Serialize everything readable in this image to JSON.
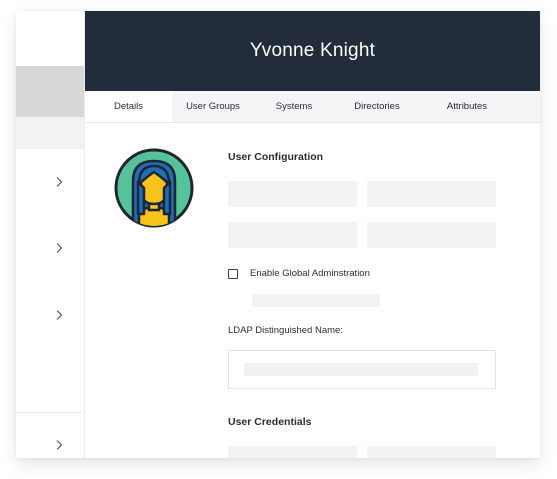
{
  "user": {
    "name": "Yvonne Knight"
  },
  "tabs": [
    {
      "label": "Details",
      "active": true
    },
    {
      "label": "User Groups",
      "active": false
    },
    {
      "label": "Systems",
      "active": false
    },
    {
      "label": "Directories",
      "active": false
    },
    {
      "label": "Attributes",
      "active": false
    }
  ],
  "details": {
    "user_configuration_title": "User Configuration",
    "global_admin_label": "Enable Global Adminstration",
    "global_admin_checked": false,
    "ldap_label": "LDAP Distinguished Name:",
    "user_credentials_title": "User Credentials"
  },
  "sidebar": {
    "row_icon": "chevron-right-icon"
  },
  "colors": {
    "header_bg": "#222c3a",
    "avatar_bg": "#55c29c",
    "avatar_hair": "#1d6fb8",
    "avatar_skin": "#f7c21b"
  }
}
